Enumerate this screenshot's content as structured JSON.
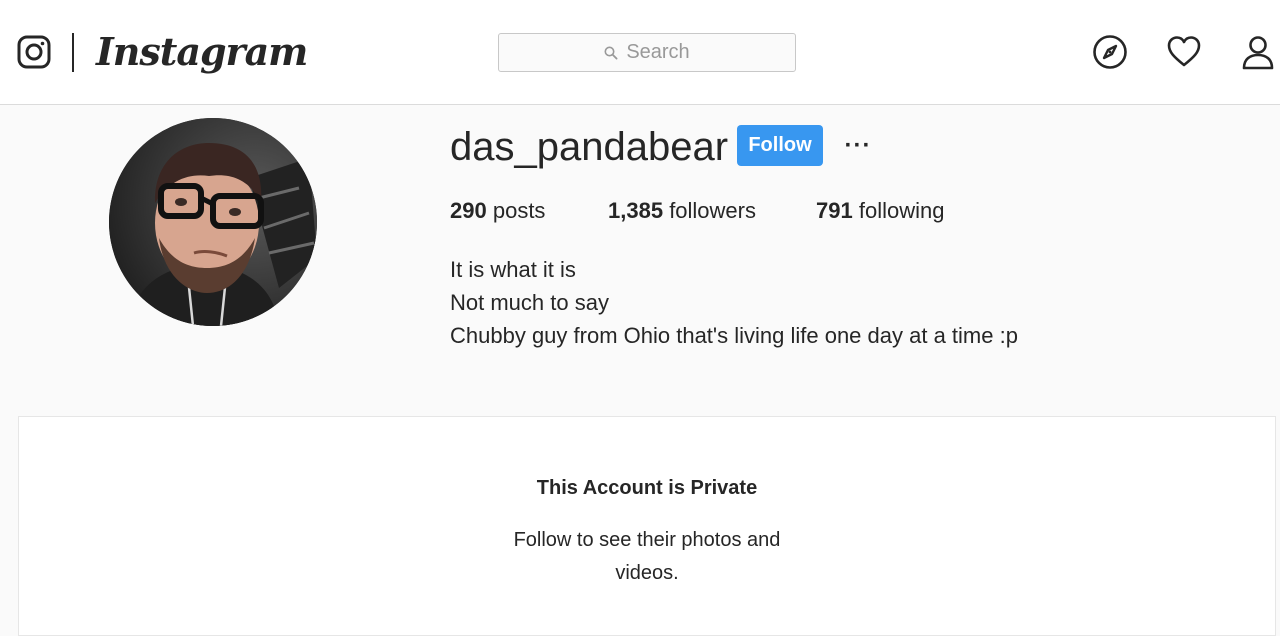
{
  "header": {
    "brand": "Instagram",
    "search": {
      "placeholder": "Search",
      "value": ""
    },
    "icons": {
      "logo": "instagram-camera-icon",
      "explore": "compass-icon",
      "activity": "heart-icon",
      "profile": "person-icon",
      "search": "search-icon"
    }
  },
  "profile": {
    "username": "das_pandabear",
    "follow_label": "Follow",
    "more_label": "···",
    "stats": {
      "posts_count": "290",
      "posts_label": "posts",
      "followers_count": "1,385",
      "followers_label": "followers",
      "following_count": "791",
      "following_label": "following"
    },
    "bio": [
      "It is what it is",
      "Not much to say",
      "Chubby guy from Ohio that's living life one day at a time :p"
    ]
  },
  "private_notice": {
    "title": "This Account is Private",
    "description": "Follow to see their photos and videos."
  },
  "colors": {
    "accent": "#3897f0",
    "background": "#fafafa",
    "text": "#262626",
    "border": "#dbdbdb",
    "placeholder": "#999999"
  }
}
